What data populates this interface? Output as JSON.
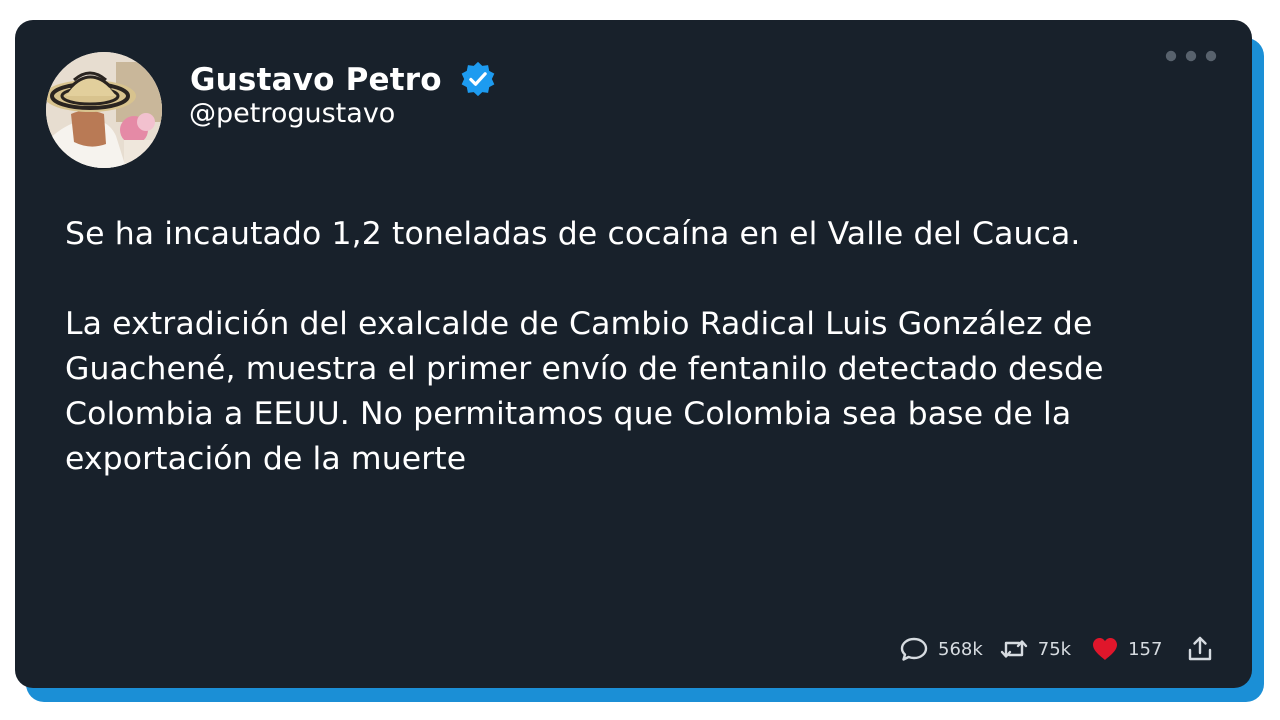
{
  "author": {
    "display_name": "Gustavo Petro",
    "handle": "@petrogustavo",
    "verified": true
  },
  "tweet": {
    "paragraphs": [
      "Se ha incautado 1,2 toneladas de cocaína en el Valle del Cauca.",
      "La extradición del exalcalde de Cambio Radical Luis González de Guachené, muestra el primer envío de fentanilo detectado desde Colombia a EEUU. No permitamos que Colombia sea base de la exportación de la muerte"
    ]
  },
  "actions": {
    "replies": "568k",
    "retweets": "75k",
    "likes": "157"
  },
  "icons": {
    "verified": "verified-badge-icon",
    "more": "more-options-icon",
    "reply": "comment-icon",
    "retweet": "retweet-icon",
    "like": "heart-icon",
    "share": "share-icon"
  },
  "colors": {
    "card_background": "#18212b",
    "accent_shadow": "#1b8fd6",
    "verified_blue": "#1d9bf0",
    "like_red": "#e0162b",
    "text": "#ffffff",
    "muted": "#d6dbe0"
  }
}
